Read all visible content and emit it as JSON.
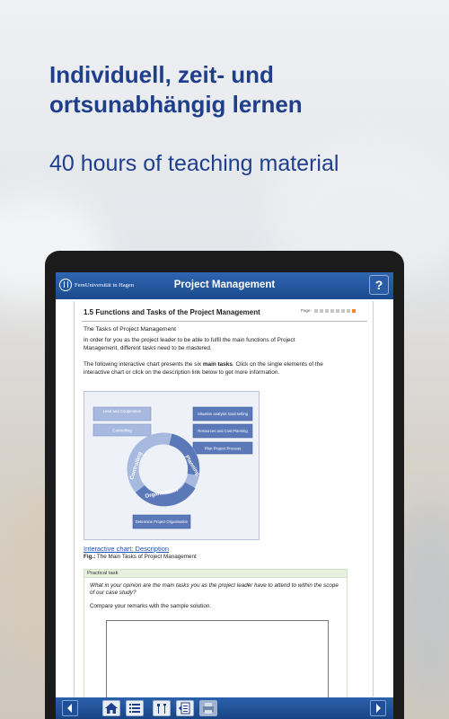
{
  "promo": {
    "headline": "Individuell, zeit- und ortsunabhängig lernen",
    "subline": "40 hours of teaching material"
  },
  "app": {
    "logo_text": "FernUniversität in Hagen",
    "title": "Project Management",
    "help_label": "?"
  },
  "page": {
    "heading": "1.5 Functions and Tasks of the Project Management",
    "page_label": "Page:",
    "page_count": 8,
    "current_page": 8,
    "section_title": "The Tasks of Project Management",
    "paragraph1": "In order for you as the project leader to be able to fulfil the main functions of Project Management, different tasks need to be mastered.",
    "paragraph2_before": "The following interactive chart presents the six ",
    "paragraph2_bold": "main tasks",
    "paragraph2_after": ". Click on the single elements of the interactive chart or click on the description link below to get more information."
  },
  "diagram": {
    "boxes": {
      "lead": "Lead and Cooperation",
      "controlling": "Controlling",
      "situation": "Situation analysis Goal setting",
      "resources": "Resources and Cost Planning",
      "plan": "Plan Project Process",
      "determine": "Determine Project Organisation"
    },
    "ring": {
      "planning": "Planning",
      "organisation": "Organisation",
      "controlling": "Controlling"
    }
  },
  "figure": {
    "link": "Interactive chart: Description",
    "caption_prefix": "Fig.:",
    "caption": " The Main Tasks of Project Management"
  },
  "task": {
    "header": "Practical task",
    "question": "What in your opinion are the main tasks you as the project leader have to attend to within the scope of our case study?",
    "instruction": "Compare your remarks with the sample solution."
  },
  "colors": {
    "brand_blue": "#1f3f8c",
    "toolbar_blue": "#1b4a8f",
    "diagram_blue": "#5b78b8",
    "diagram_light": "#a8b9df",
    "progress_orange": "#f08a2c"
  }
}
